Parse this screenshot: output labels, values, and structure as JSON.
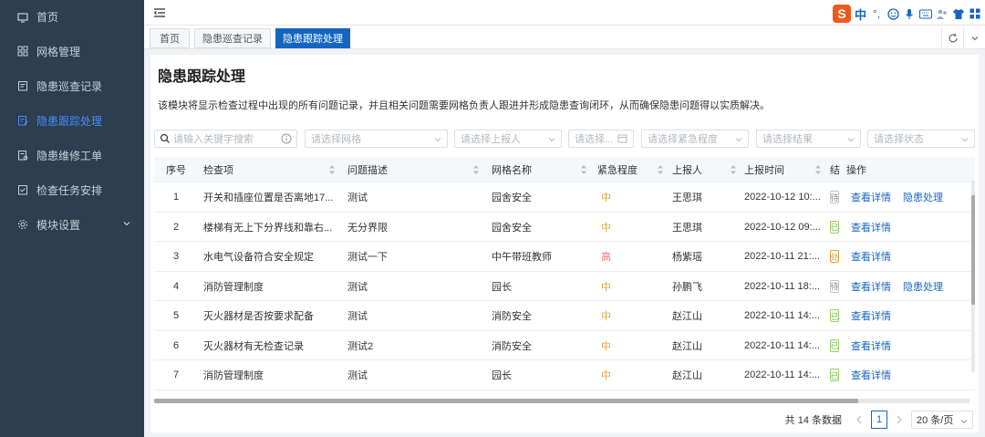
{
  "sidebar": {
    "items": [
      {
        "label": "首页",
        "icon": "monitor-icon",
        "active": false
      },
      {
        "label": "网格管理",
        "icon": "grid-icon",
        "active": false
      },
      {
        "label": "隐患巡查记录",
        "icon": "clipboard-icon",
        "active": false
      },
      {
        "label": "隐患跟踪处理",
        "icon": "edit-list-icon",
        "active": true
      },
      {
        "label": "隐患维修工单",
        "icon": "wrench-doc-icon",
        "active": false
      },
      {
        "label": "检查任务安排",
        "icon": "checklist-icon",
        "active": false
      },
      {
        "label": "模块设置",
        "icon": "gear-icon",
        "active": false,
        "expandable": true
      }
    ]
  },
  "tabs": [
    {
      "label": "首页",
      "active": false
    },
    {
      "label": "隐患巡查记录",
      "active": false
    },
    {
      "label": "隐患跟踪处理",
      "active": true
    }
  ],
  "ime": {
    "mode_label": "中",
    "punct_label": "°,"
  },
  "page": {
    "title": "隐患跟踪处理",
    "description": "该模块将显示检查过程中出现的所有问题记录，并且相关问题需要网格负责人跟进并形成隐患查询闭环，从而确保隐患问题得以实质解决。"
  },
  "filters": {
    "keyword_placeholder": "请输入关键字搜索",
    "grid_placeholder": "请选择网格",
    "reporter_placeholder": "请选择上报人",
    "date_placeholder": "请选择...",
    "urgency_placeholder": "请选择紧急程度",
    "result_placeholder": "请选择结果",
    "status_placeholder": "请选择状态"
  },
  "table": {
    "headers": {
      "index": "序号",
      "item": "检查项",
      "problem": "问题描述",
      "grid": "网格名称",
      "urgency": "紧急程度",
      "reporter": "上报人",
      "time": "上报时间",
      "result": "结",
      "actions": "操作"
    },
    "rows": [
      {
        "index": "1",
        "item": "开关和插座位置是否离地17...",
        "problem": "测试",
        "grid": "园舍安全",
        "urgency": "中",
        "urgency_level": "mid",
        "reporter": "王思琪",
        "time": "2022-10-12 10:...",
        "result_badge": "待",
        "result_color": "gray",
        "view": "查看详情",
        "handle": "隐患处理"
      },
      {
        "index": "2",
        "item": "楼梯有无上下分界线和靠右...",
        "problem": "无分界限",
        "grid": "园舍安全",
        "urgency": "中",
        "urgency_level": "mid",
        "reporter": "王思琪",
        "time": "2022-10-12 09:...",
        "result_badge": "已",
        "result_color": "green",
        "view": "查看详情",
        "handle": ""
      },
      {
        "index": "3",
        "item": "水电气设备符合安全规定",
        "problem": "测试一下",
        "grid": "中午带班教师",
        "urgency": "高",
        "urgency_level": "high",
        "reporter": "杨紫瑶",
        "time": "2022-10-11 21:...",
        "result_badge": "处",
        "result_color": "yellow",
        "view": "查看详情",
        "handle": ""
      },
      {
        "index": "4",
        "item": "消防管理制度",
        "problem": "测试",
        "grid": "园长",
        "urgency": "中",
        "urgency_level": "mid",
        "reporter": "孙鹏飞",
        "time": "2022-10-11 18:...",
        "result_badge": "待",
        "result_color": "gray",
        "view": "查看详情",
        "handle": "隐患处理"
      },
      {
        "index": "5",
        "item": "灭火器材是否按要求配备",
        "problem": "测试",
        "grid": "消防安全",
        "urgency": "中",
        "urgency_level": "mid",
        "reporter": "赵江山",
        "time": "2022-10-11 14:...",
        "result_badge": "已",
        "result_color": "green",
        "view": "查看详情",
        "handle": ""
      },
      {
        "index": "6",
        "item": "灭火器材有无检查记录",
        "problem": "测试2",
        "grid": "消防安全",
        "urgency": "中",
        "urgency_level": "mid",
        "reporter": "赵江山",
        "time": "2022-10-11 14:...",
        "result_badge": "已",
        "result_color": "green",
        "view": "查看详情",
        "handle": ""
      },
      {
        "index": "7",
        "item": "消防管理制度",
        "problem": "测试",
        "grid": "园长",
        "urgency": "中",
        "urgency_level": "mid",
        "reporter": "赵江山",
        "time": "2022-10-11 14:...",
        "result_badge": "已",
        "result_color": "green",
        "view": "查看详情",
        "handle": ""
      }
    ]
  },
  "pagination": {
    "total_label": "共 14 条数据",
    "current_page": "1",
    "page_size_label": "20 条/页"
  },
  "colors": {
    "sidebar_bg": "#2c3e50",
    "accent": "#1565c0",
    "urgency_mid": "#e6a23c",
    "urgency_high": "#f56c6c"
  }
}
